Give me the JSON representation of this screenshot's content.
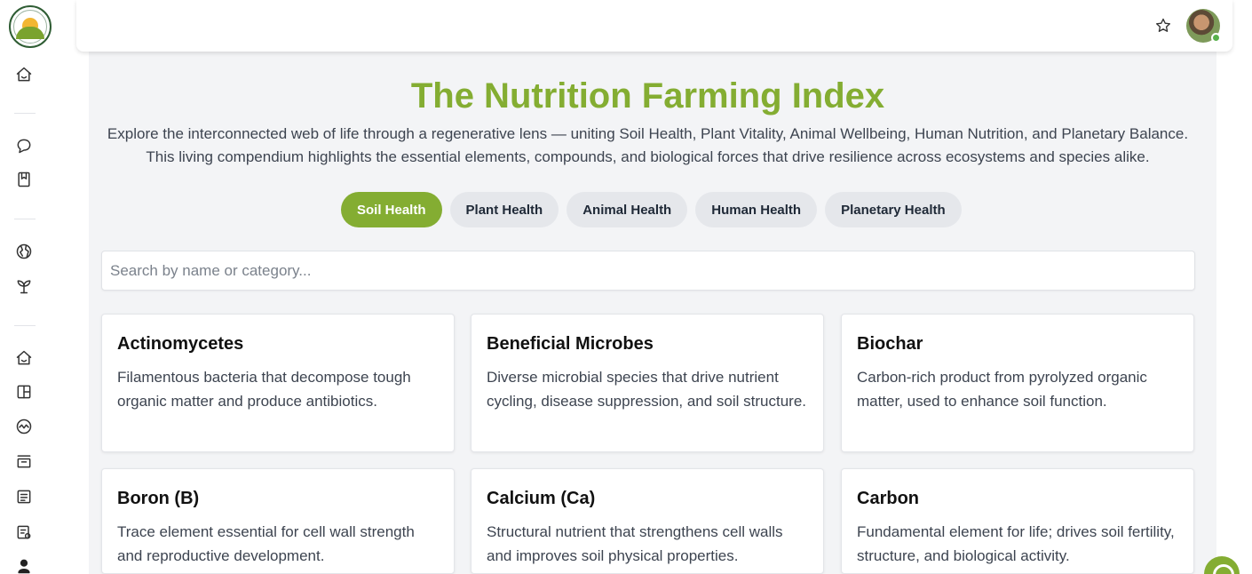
{
  "header": {
    "title": "The Nutrition Farming Index",
    "intro": "Explore the interconnected web of life through a regenerative lens — uniting Soil Health, Plant Vitality, Animal Wellbeing, Human Nutrition, and Planetary Balance. This living compendium highlights the essential elements, compounds, and biological forces that drive resilience across ecosystems and species alike."
  },
  "tabs": [
    {
      "label": "Soil Health",
      "active": true
    },
    {
      "label": "Plant Health",
      "active": false
    },
    {
      "label": "Animal Health",
      "active": false
    },
    {
      "label": "Human Health",
      "active": false
    },
    {
      "label": "Planetary Health",
      "active": false
    }
  ],
  "search": {
    "placeholder": "Search by name or category...",
    "value": ""
  },
  "cards": [
    {
      "title": "Actinomycetes",
      "description": "Filamentous bacteria that decompose tough organic matter and produce antibiotics."
    },
    {
      "title": "Beneficial Microbes",
      "description": "Diverse microbial species that drive nutrient cycling, disease suppression, and soil structure."
    },
    {
      "title": "Biochar",
      "description": "Carbon-rich product from pyrolyzed organic matter, used to enhance soil function."
    },
    {
      "title": "Boron (B)",
      "description": "Trace element essential for cell wall strength and reproductive development."
    },
    {
      "title": "Calcium (Ca)",
      "description": "Structural nutrient that strengthens cell walls and improves soil physical properties."
    },
    {
      "title": "Carbon",
      "description": "Fundamental element for life; drives soil fertility, structure, and biological activity."
    }
  ],
  "sidebar": {
    "icons": [
      "home-icon",
      "chat-icon",
      "bookmark-icon",
      "globe-icon",
      "sprout-icon",
      "home-icon",
      "layout-icon",
      "activity-icon",
      "archive-icon",
      "list-icon",
      "receipt-icon",
      "user-icon"
    ]
  },
  "topbar": {
    "icons": [
      "star-icon",
      "avatar"
    ]
  },
  "colors": {
    "accent": "#84ad32",
    "tab_inactive": "#e5e7eb",
    "background": "#f3f4f6"
  }
}
